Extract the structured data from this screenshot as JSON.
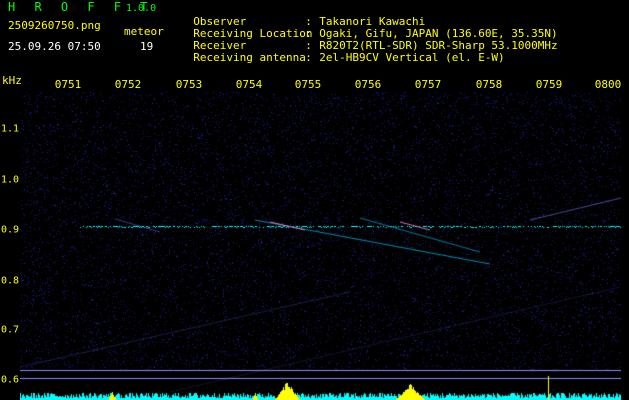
{
  "header": {
    "app_title": "H R O F F T",
    "app_version": "1.0.0",
    "file_name": "2509260750.png",
    "meteor_label": "meteor",
    "timestamp": "25.09.26 07:50",
    "meteor_count": "19"
  },
  "info": [
    {
      "key": "Observer",
      "sep": ":",
      "value": "Takanori Kawachi"
    },
    {
      "key": "Receiving Location",
      "sep": ":",
      "value": "Ogaki, Gifu, JAPAN (136.60E, 35.35N)"
    },
    {
      "key": "Receiver",
      "sep": ":",
      "value": "R820T2(RTL-SDR) SDR-Sharp 53.1000MHz"
    },
    {
      "key": "Receiving antenna",
      "sep": ":",
      "value": "2el-HB9CV Vertical (el. E-W)"
    }
  ],
  "axis": {
    "y_unit": "kHz",
    "time_ticks": [
      "0751",
      "0752",
      "0753",
      "0754",
      "0755",
      "0756",
      "0757",
      "0758",
      "0759",
      "0800"
    ],
    "freq_ticks": [
      "1.1",
      "1.0",
      "0.9",
      "0.8",
      "0.7",
      "0.6"
    ]
  },
  "colors": {
    "label": "#ffff00",
    "title": "#00ff00",
    "background": "#000000",
    "noise": "#1a1a8a",
    "trace": "#00ffff"
  }
}
